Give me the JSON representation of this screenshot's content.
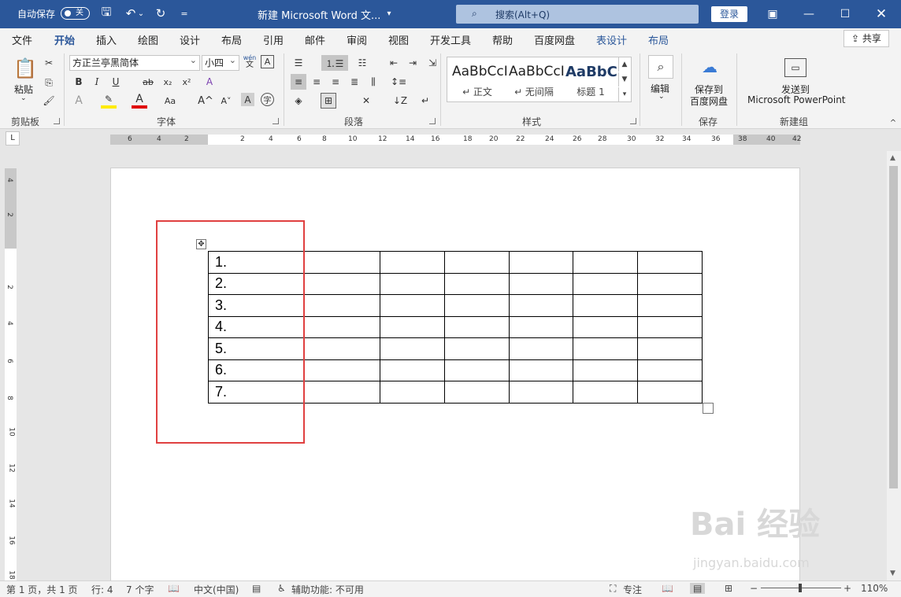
{
  "titlebar": {
    "autosave_label": "自动保存",
    "autosave_state": "关",
    "doc_title": "新建 Microsoft Word 文...",
    "search_placeholder": "搜索(Alt+Q)",
    "login": "登录"
  },
  "menu": {
    "items": [
      "文件",
      "开始",
      "插入",
      "绘图",
      "设计",
      "布局",
      "引用",
      "邮件",
      "审阅",
      "视图",
      "开发工具",
      "帮助",
      "百度网盘",
      "表设计",
      "布局"
    ],
    "active": "开始",
    "share": "共享"
  },
  "ribbon": {
    "clipboard": {
      "paste": "粘贴",
      "label": "剪贴板"
    },
    "font": {
      "name": "方正兰亭黑简体",
      "size": "小四",
      "wen": "wén",
      "wen2": "文",
      "label": "字体"
    },
    "paragraph": {
      "label": "段落"
    },
    "styles": {
      "label": "样式",
      "items": [
        {
          "preview": "AaBbCcI",
          "name": "↵ 正文"
        },
        {
          "preview": "AaBbCcI",
          "name": "↵ 无间隔"
        },
        {
          "preview": "AaBbC",
          "name": "标题 1"
        }
      ]
    },
    "editing": {
      "label": "编辑"
    },
    "save": {
      "line1": "保存到",
      "line2": "百度网盘",
      "label": "保存"
    },
    "newgroup": {
      "line1": "发送到",
      "line2": "Microsoft PowerPoint",
      "label": "新建组"
    }
  },
  "ruler": {
    "h_numbers": [
      "6",
      "4",
      "2",
      "2",
      "4",
      "6",
      "8",
      "10",
      "12",
      "14",
      "16",
      "18",
      "20",
      "22",
      "24",
      "26",
      "28",
      "30",
      "32",
      "34",
      "36",
      "38",
      "40",
      "42"
    ],
    "v_numbers": [
      "4",
      "2",
      "2",
      "4",
      "6",
      "8",
      "10",
      "12",
      "14",
      "16",
      "18"
    ]
  },
  "document": {
    "table": {
      "rows": 7,
      "cols": 6,
      "first_col": [
        "1.",
        "2.",
        "3.",
        "4.",
        "5.",
        "6.",
        "7."
      ]
    }
  },
  "statusbar": {
    "page": "第 1 页，共 1 页",
    "line": "行: 4",
    "words": "7 个字",
    "lang": "中文(中国)",
    "accessibility": "辅助功能: 不可用",
    "focus": "专注",
    "zoom": "110%"
  },
  "watermark": {
    "main": "Bai 经验",
    "sub": "jingyan.baidu.com"
  }
}
